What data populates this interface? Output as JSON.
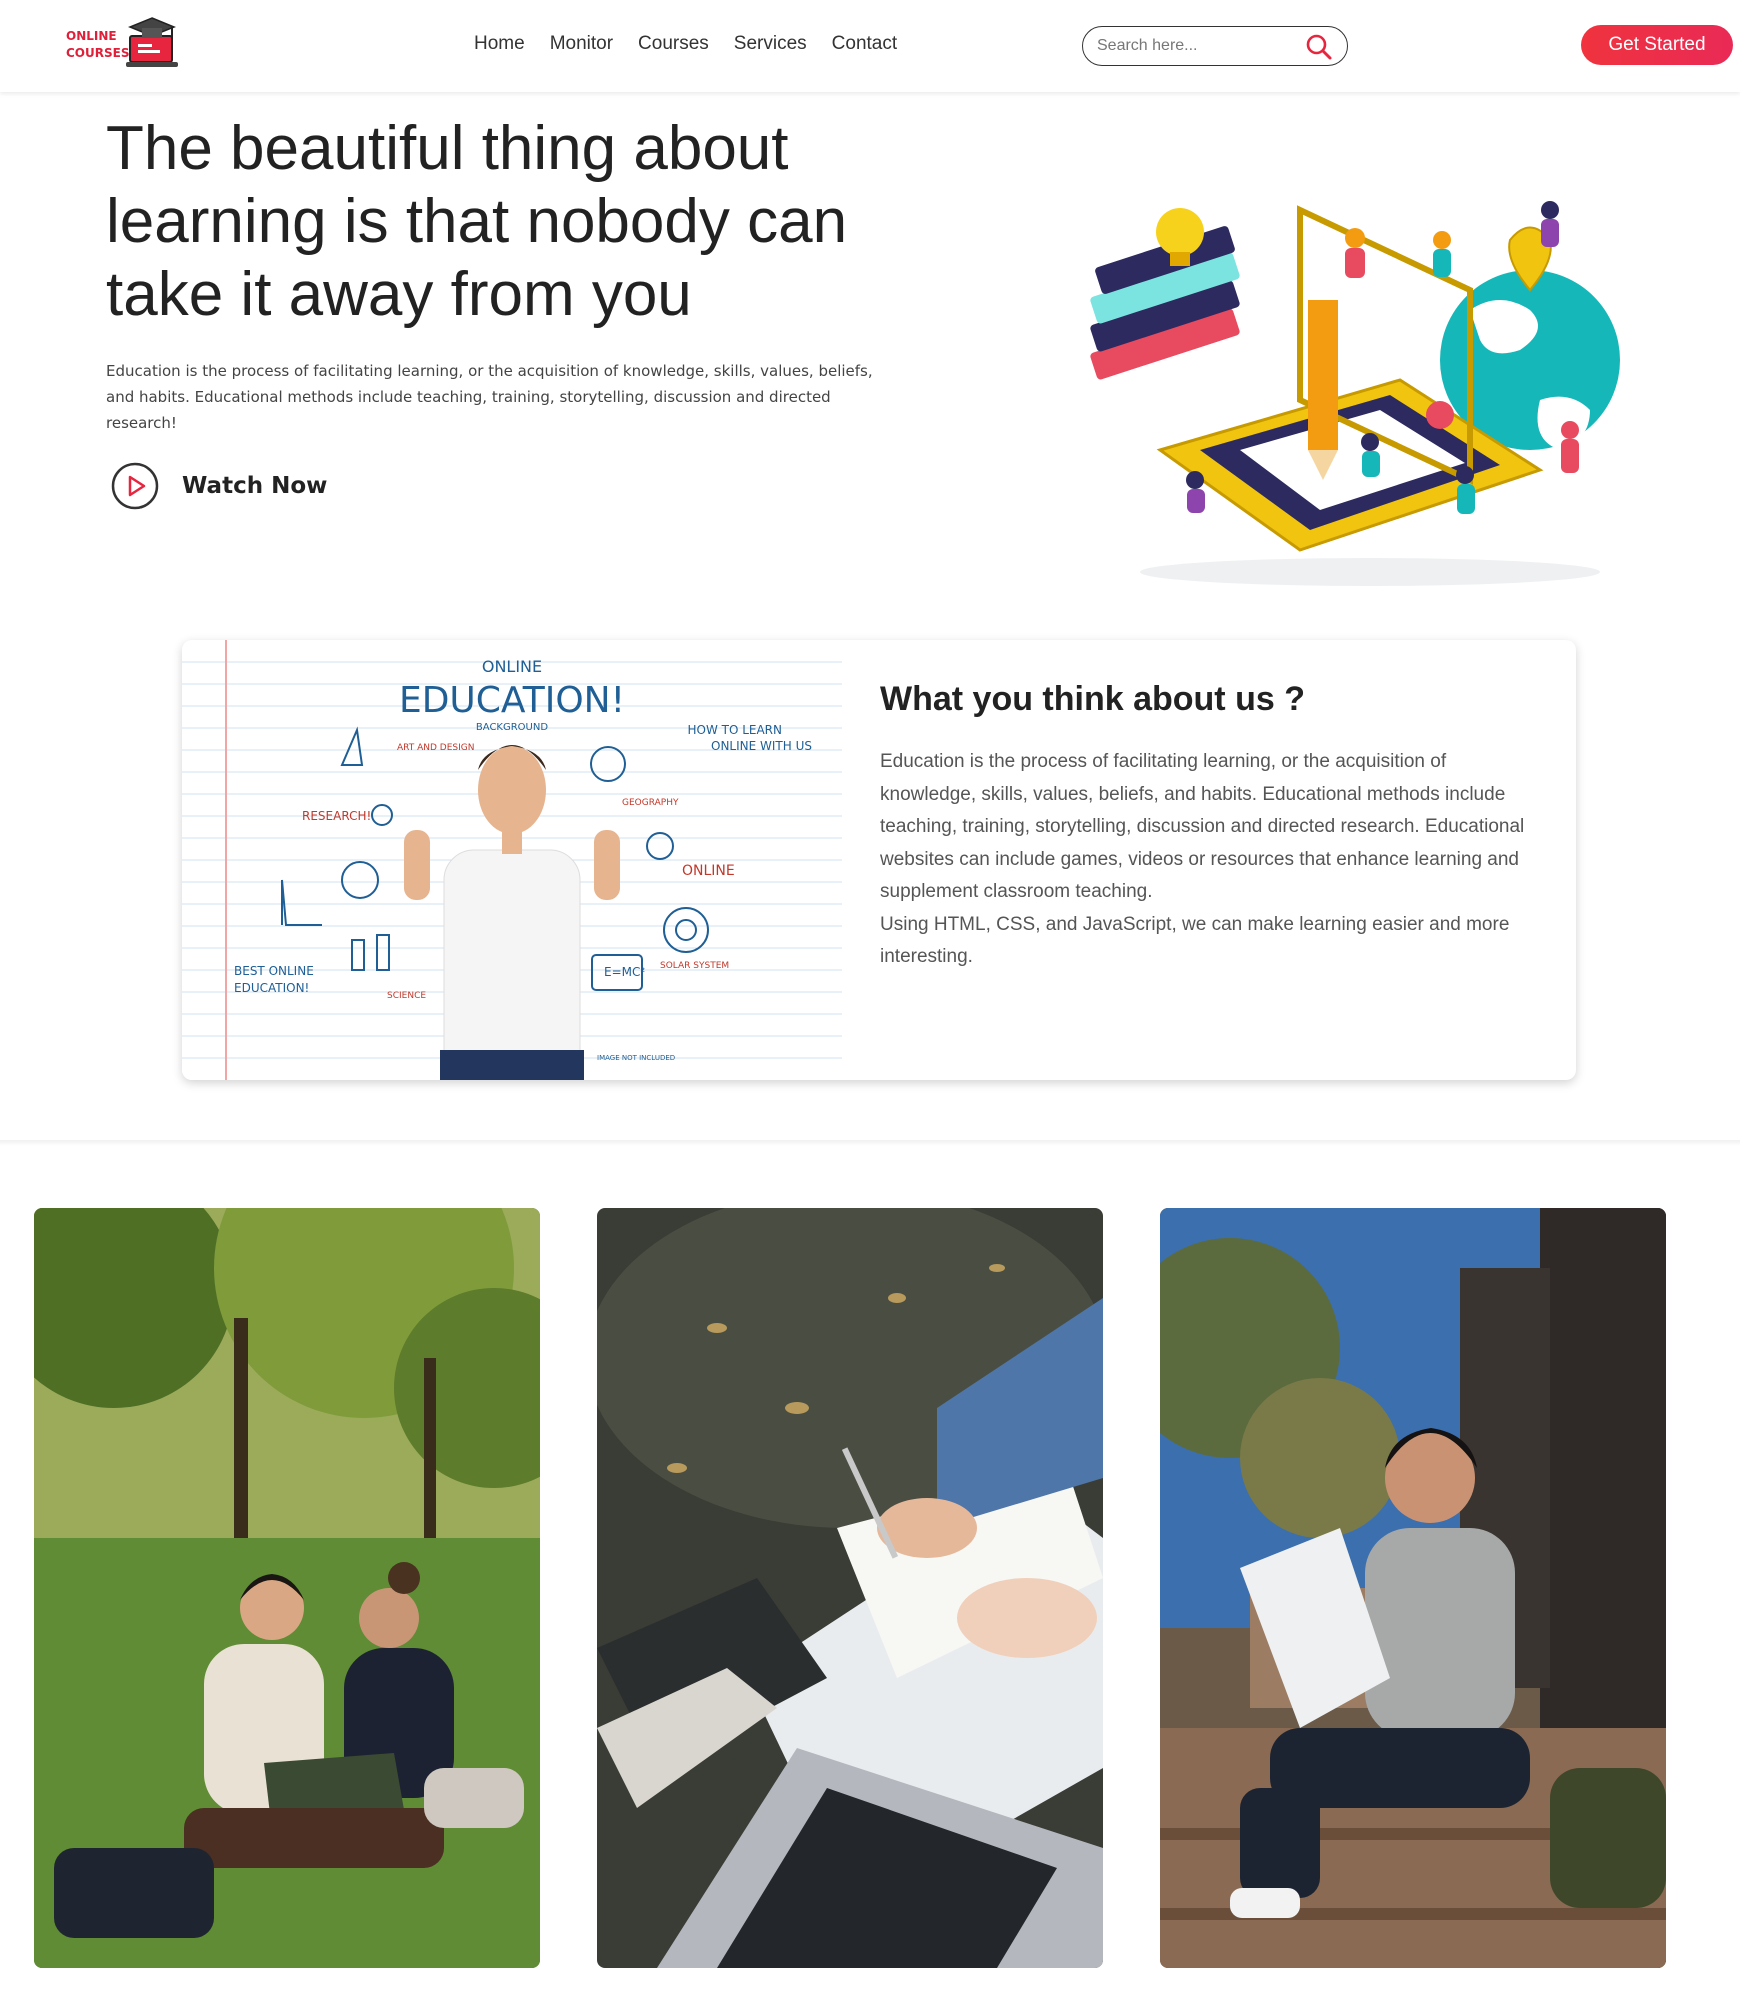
{
  "brand": {
    "logo_line1": "ONLINE",
    "logo_line2": "COURSES",
    "accent": "#e8253f"
  },
  "nav": {
    "items": [
      "Home",
      "Monitor",
      "Courses",
      "Services",
      "Contact"
    ]
  },
  "search": {
    "placeholder": "Search here...",
    "icon": "search-icon"
  },
  "header": {
    "cta_label": "Get Started"
  },
  "hero": {
    "title": "The beautiful thing about learning is that nobody can take it away from you",
    "text": "Education is the process of facilitating learning, or the acquisition of knowledge, skills, values, beliefs, and habits. Educational methods include teaching, training, storytelling, discussion and directed research!",
    "watch_label": "Watch Now"
  },
  "about": {
    "title": "What you think about us ?",
    "paragraph1": "Education is the process of facilitating learning, or the acquisition of knowledge, skills, values, beliefs, and habits. Educational methods include teaching, training, storytelling, discussion and directed research. Educational websites can include games, videos or resources that enhance learning and supplement classroom teaching.",
    "paragraph2": "Using HTML, CSS, and JavaScript, we can make learning easier and more interesting.",
    "image": {
      "heading_small": "ONLINE",
      "heading": "EDUCATION!",
      "sub": "BACKGROUND",
      "how_to": "HOW TO LEARN",
      "online_with_us": "ONLINE WITH US",
      "research": "RESEARCH!",
      "art_design": "ART AND DESIGN",
      "geography": "GEOGRAPHY",
      "online": "ONLINE",
      "best_online": "BEST ONLINE",
      "education": "EDUCATION!",
      "science": "SCIENCE",
      "solar": "SOLAR SYSTEM",
      "formula": "E=MC²",
      "not_included": "IMAGE NOT INCLUDED"
    }
  },
  "photos": [
    {
      "subject": "students-studying-on-grass"
    },
    {
      "subject": "hands-writing-notes-by-laptop"
    },
    {
      "subject": "student-sitting-on-steps-with-papers"
    }
  ]
}
